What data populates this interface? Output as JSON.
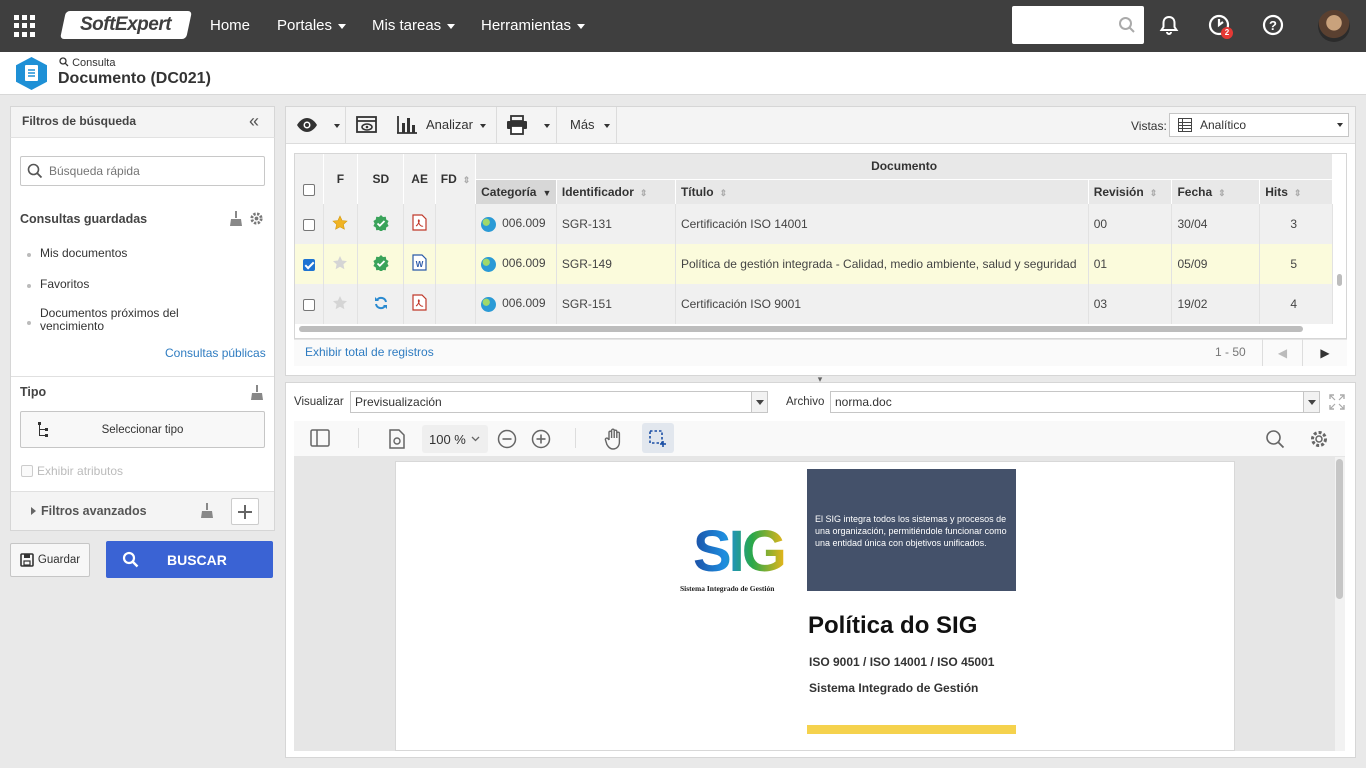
{
  "topnav": {
    "logo": "SoftExpert",
    "menu": [
      {
        "label": "Home",
        "has_caret": false
      },
      {
        "label": "Portales",
        "has_caret": true
      },
      {
        "label": "Mis tareas",
        "has_caret": true
      },
      {
        "label": "Herramientas",
        "has_caret": true
      }
    ],
    "search_value": "",
    "task_badge": "2",
    "icons": [
      "apps-grid-icon",
      "search-icon",
      "bell-icon",
      "tasks-icon",
      "help-icon",
      "user-avatar"
    ]
  },
  "header": {
    "breadcrumb": "Consulta",
    "title": "Documento (DC021)"
  },
  "filters": {
    "title": "Filtros de búsqueda",
    "quick_search_placeholder": "Búsqueda rápida",
    "saved_queries_label": "Consultas guardadas",
    "saved_queries": [
      "Mis documentos",
      "Favoritos",
      "Documentos próximos del vencimiento"
    ],
    "public_queries_link": "Consultas públicas",
    "tipo_label": "Tipo",
    "select_type_button": "Seleccionar tipo",
    "show_attributes_label": "Exhibir atributos",
    "show_attributes_checked": false,
    "advanced_filters_label": "Filtros avanzados",
    "save_button": "Guardar",
    "search_button": "BUSCAR"
  },
  "toolbar": {
    "analyze_label": "Analizar",
    "more_label": "Más",
    "views_label": "Vistas:",
    "views_value": "Analítico"
  },
  "grid": {
    "group_header": "Documento",
    "columns": [
      "F",
      "SD",
      "AE",
      "FD",
      "Categoría",
      "Identificador",
      "Título",
      "Revisión",
      "Fecha",
      "Hits"
    ],
    "rows": [
      {
        "selected": false,
        "favorite": true,
        "status": "approved",
        "file_type": "pdf",
        "category": "006.009",
        "identifier": "SGR-131",
        "title": "Certificación ISO 14001",
        "revision": "00",
        "date": "30/04",
        "hits": "3"
      },
      {
        "selected": true,
        "favorite": false,
        "status": "approved",
        "file_type": "doc",
        "category": "006.009",
        "identifier": "SGR-149",
        "title": "Política de gestión integrada - Calidad, medio ambiente, salud y seguridad",
        "revision": "01",
        "date": "05/09",
        "hits": "5"
      },
      {
        "selected": false,
        "favorite": false,
        "status": "in-revision",
        "file_type": "pdf",
        "category": "006.009",
        "identifier": "SGR-151",
        "title": "Certificación ISO 9001",
        "revision": "03",
        "date": "19/02",
        "hits": "4"
      }
    ],
    "show_total_link": "Exhibir total de registros",
    "page_range": "1 - 50"
  },
  "preview": {
    "view_label": "Visualizar",
    "view_value": "Previsualización",
    "file_label": "Archivo",
    "file_value": "norma.doc",
    "zoom": "100 %",
    "document": {
      "logo_text": "SIG",
      "logo_caption": "Sistema Integrado de Gestión",
      "intro": "El SIG integra todos los sistemas y procesos de una organización, permitiéndole funcionar como una entidad única con objetivos unificados.",
      "title": "Política do SIG",
      "standards": "ISO 9001 / ISO 14001 / ISO 45001",
      "subtitle": "Sistema Integrado de Gestión"
    }
  },
  "colors": {
    "topnav_bg": "#3f3f3f",
    "primary_button": "#3a63d4",
    "selected_row": "#fbfbdc",
    "link": "#2f7cc1",
    "approved_green": "#3aa35a",
    "doc_header_dark": "#44516a"
  }
}
